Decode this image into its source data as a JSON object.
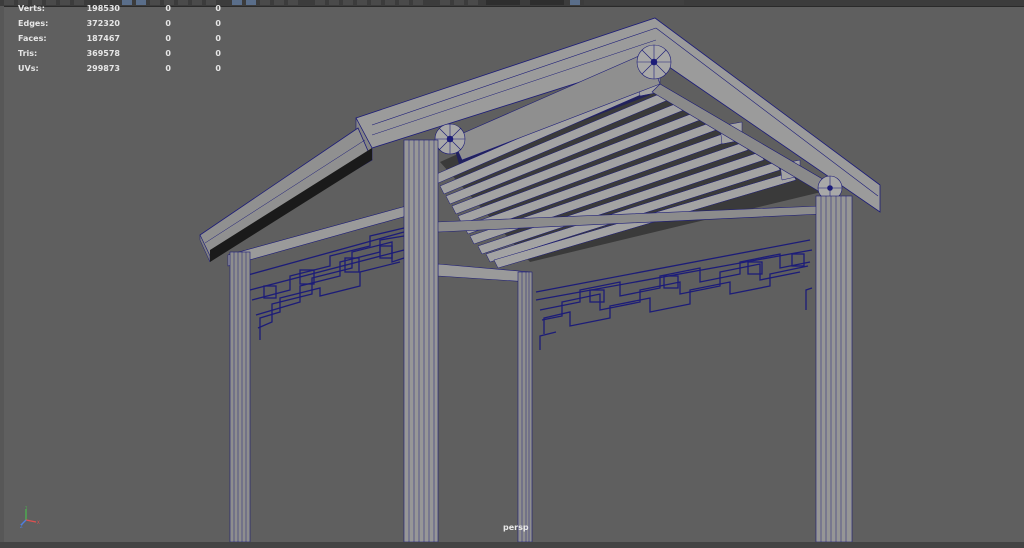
{
  "viewport": {
    "camera_label": "persp",
    "axis": {
      "x": "X",
      "y": "Y",
      "z": "Z"
    }
  },
  "hud": {
    "rows": [
      {
        "label": "Verts:",
        "v1": "198530",
        "v2": "0",
        "v3": "0"
      },
      {
        "label": "Edges:",
        "v1": "372320",
        "v2": "0",
        "v3": "0"
      },
      {
        "label": "Faces:",
        "v1": "187467",
        "v2": "0",
        "v3": "0"
      },
      {
        "label": "Tris:",
        "v1": "369578",
        "v2": "0",
        "v3": "0"
      },
      {
        "label": "UVs:",
        "v1": "299873",
        "v2": "0",
        "v3": "0"
      }
    ]
  },
  "colors": {
    "background": "#5f5f5f",
    "wire": "#1c1c78",
    "geometry": "#9a9a9a"
  }
}
